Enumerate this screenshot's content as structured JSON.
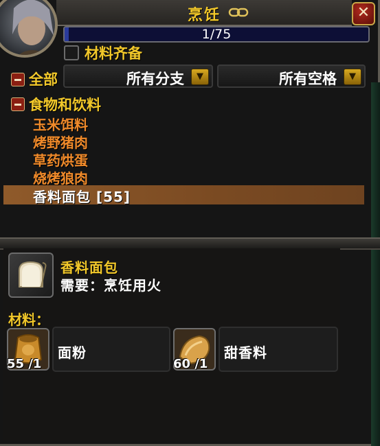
{
  "window": {
    "title": "烹饪",
    "close_label": "✕",
    "title_icon": "chain-link-icon"
  },
  "progress": {
    "text": "1/75",
    "current": 1,
    "max": 75
  },
  "filters": {
    "have_materials_label": "材料齐备",
    "have_materials_checked": false,
    "all_label": "全部",
    "subclass_dropdown": "所有分支",
    "slot_dropdown": "所有空格"
  },
  "recipes": {
    "category": "食物和饮料",
    "items": [
      "玉米饵料",
      "烤野猪肉",
      "草药烘蛋",
      "烧烤狼肉"
    ],
    "selected": "香料面包 [55]"
  },
  "detail": {
    "item_name": "香料面包",
    "requires": "需要：烹饪用火",
    "materials_label": "材料：",
    "reagents": [
      {
        "name": "面粉",
        "count": "55 /1",
        "icon": "flour-icon"
      },
      {
        "name": "甜香料",
        "count": "60 /1",
        "icon": "spices-icon"
      }
    ]
  },
  "colors": {
    "gold_text": "#f2c82a",
    "orange_recipe": "#f08a2a",
    "selected_bar": "#8f5a2a",
    "progress_fill": "#2a3a9a"
  }
}
